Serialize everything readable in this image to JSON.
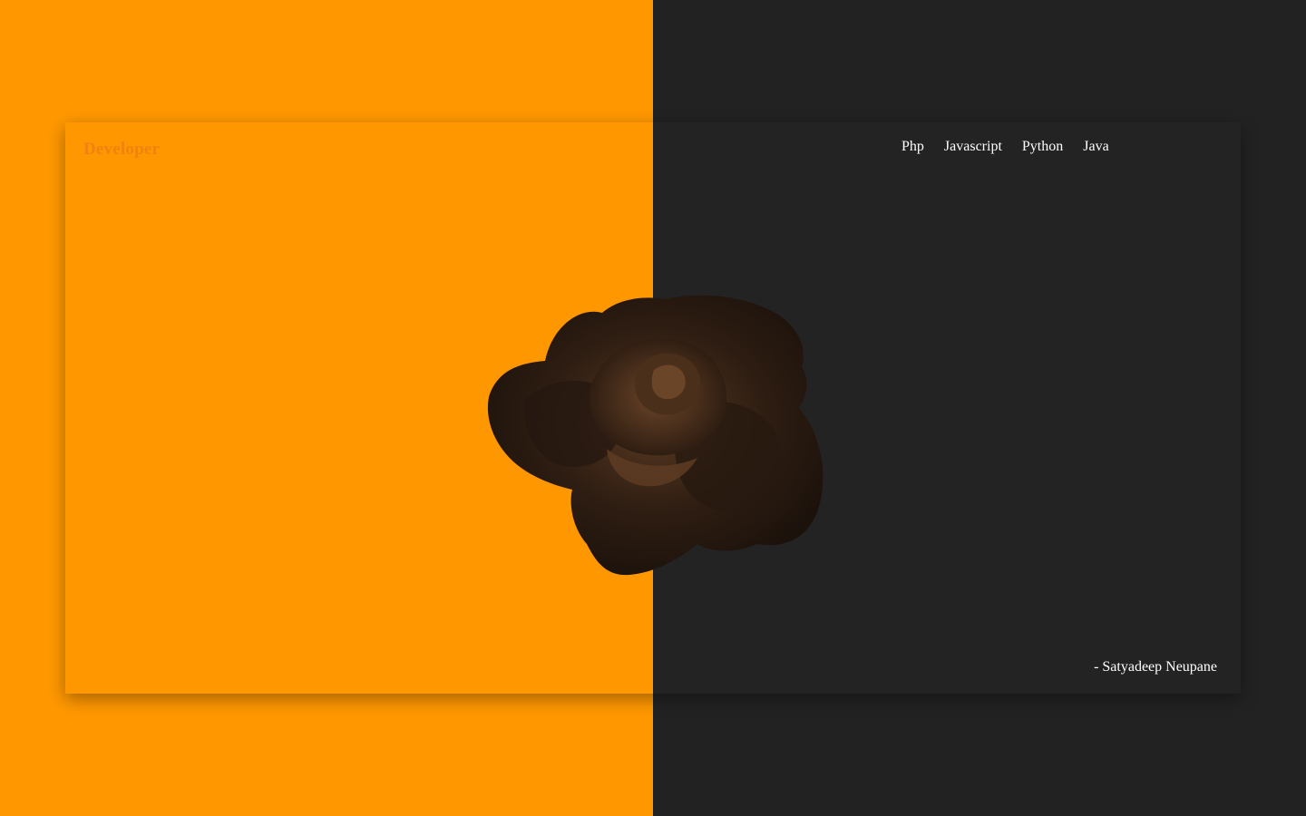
{
  "brand": {
    "title": "Developer"
  },
  "nav": {
    "items": [
      {
        "label": "Php"
      },
      {
        "label": "Javascript"
      },
      {
        "label": "Python"
      },
      {
        "label": "Java"
      }
    ]
  },
  "footer": {
    "signature": "- Satyadeep Neupane"
  },
  "colors": {
    "accent_orange": "#ff9800",
    "dark_panel": "#222222",
    "brand_text": "#f0820f",
    "rose": "#3a2516"
  },
  "hero": {
    "image": "rose-image"
  }
}
